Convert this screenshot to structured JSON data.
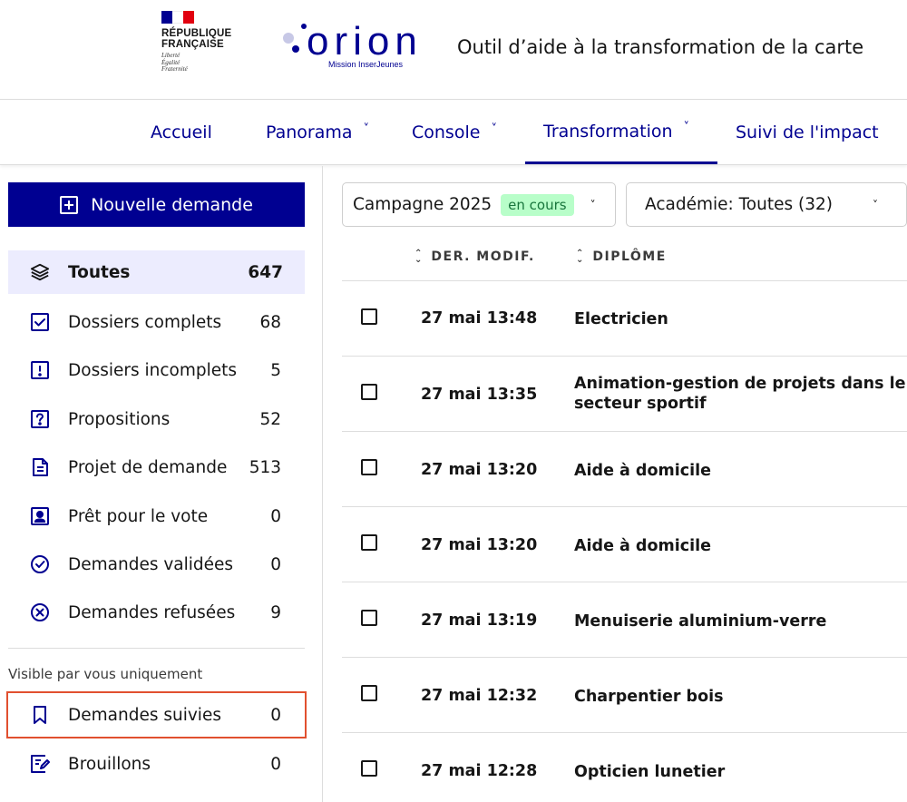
{
  "header": {
    "republique_line1": "RÉPUBLIQUE",
    "republique_line2": "FRANÇAISE",
    "motto": [
      "Liberté",
      "Égalité",
      "Fraternité"
    ],
    "logo_word": "orion",
    "logo_subtitle": "Mission InserJeunes",
    "app_title": "Outil d’aide à la transformation de la carte"
  },
  "nav": {
    "items": [
      {
        "label": "Accueil"
      },
      {
        "label": "Panorama",
        "chevron": "˅"
      },
      {
        "label": "Console",
        "chevron": "˅"
      },
      {
        "label": "Transformation",
        "chevron": "˅"
      },
      {
        "label": "Suivi de l'impact"
      }
    ]
  },
  "sidebar": {
    "new_button": "Nouvelle demande",
    "items": [
      {
        "label": "Toutes",
        "count": "647",
        "icon": "layers-icon"
      },
      {
        "label": "Dossiers complets",
        "count": "68",
        "icon": "checkbox-icon"
      },
      {
        "label": "Dossiers incomplets",
        "count": "5",
        "icon": "alert-icon"
      },
      {
        "label": "Propositions",
        "count": "52",
        "icon": "question-icon"
      },
      {
        "label": "Projet de demande",
        "count": "513",
        "icon": "document-icon"
      },
      {
        "label": "Prêt pour le vote",
        "count": "0",
        "icon": "user-card-icon"
      },
      {
        "label": "Demandes validées",
        "count": "0",
        "icon": "check-circle-icon"
      },
      {
        "label": "Demandes refusées",
        "count": "9",
        "icon": "close-circle-icon"
      }
    ],
    "visible_note": "Visible par vous uniquement",
    "private_items": [
      {
        "label": "Demandes suivies",
        "count": "0",
        "icon": "bookmark-icon"
      },
      {
        "label": "Brouillons",
        "count": "0",
        "icon": "draft-icon"
      }
    ]
  },
  "filters": {
    "campaign": "Campagne 2025",
    "campaign_badge": "en cours",
    "academie": "Académie: Toutes (32)",
    "chevron": "˅"
  },
  "table": {
    "headers": {
      "date": "DER. MODIF.",
      "diplome": "DIPLÔME"
    },
    "rows": [
      {
        "date": "27 mai 13:48",
        "diplome": "Electricien"
      },
      {
        "date": "27 mai 13:35",
        "diplome": "Animation-gestion de projets dans le secteur sportif"
      },
      {
        "date": "27 mai 13:20",
        "diplome": "Aide à domicile"
      },
      {
        "date": "27 mai 13:20",
        "diplome": "Aide à domicile"
      },
      {
        "date": "27 mai 13:19",
        "diplome": "Menuiserie aluminium-verre"
      },
      {
        "date": "27 mai 12:32",
        "diplome": "Charpentier bois"
      },
      {
        "date": "27 mai 12:28",
        "diplome": "Opticien lunetier"
      }
    ]
  },
  "colors": {
    "primary": "#000091",
    "active_bg": "#ececfe",
    "badge_bg": "#b8fec9",
    "badge_text": "#18753c",
    "highlight": "#e1502f",
    "flag_blue": "#000091",
    "flag_white": "#ffffff",
    "flag_red": "#e1000f",
    "logo_dot_light": "#c7c8e6"
  }
}
